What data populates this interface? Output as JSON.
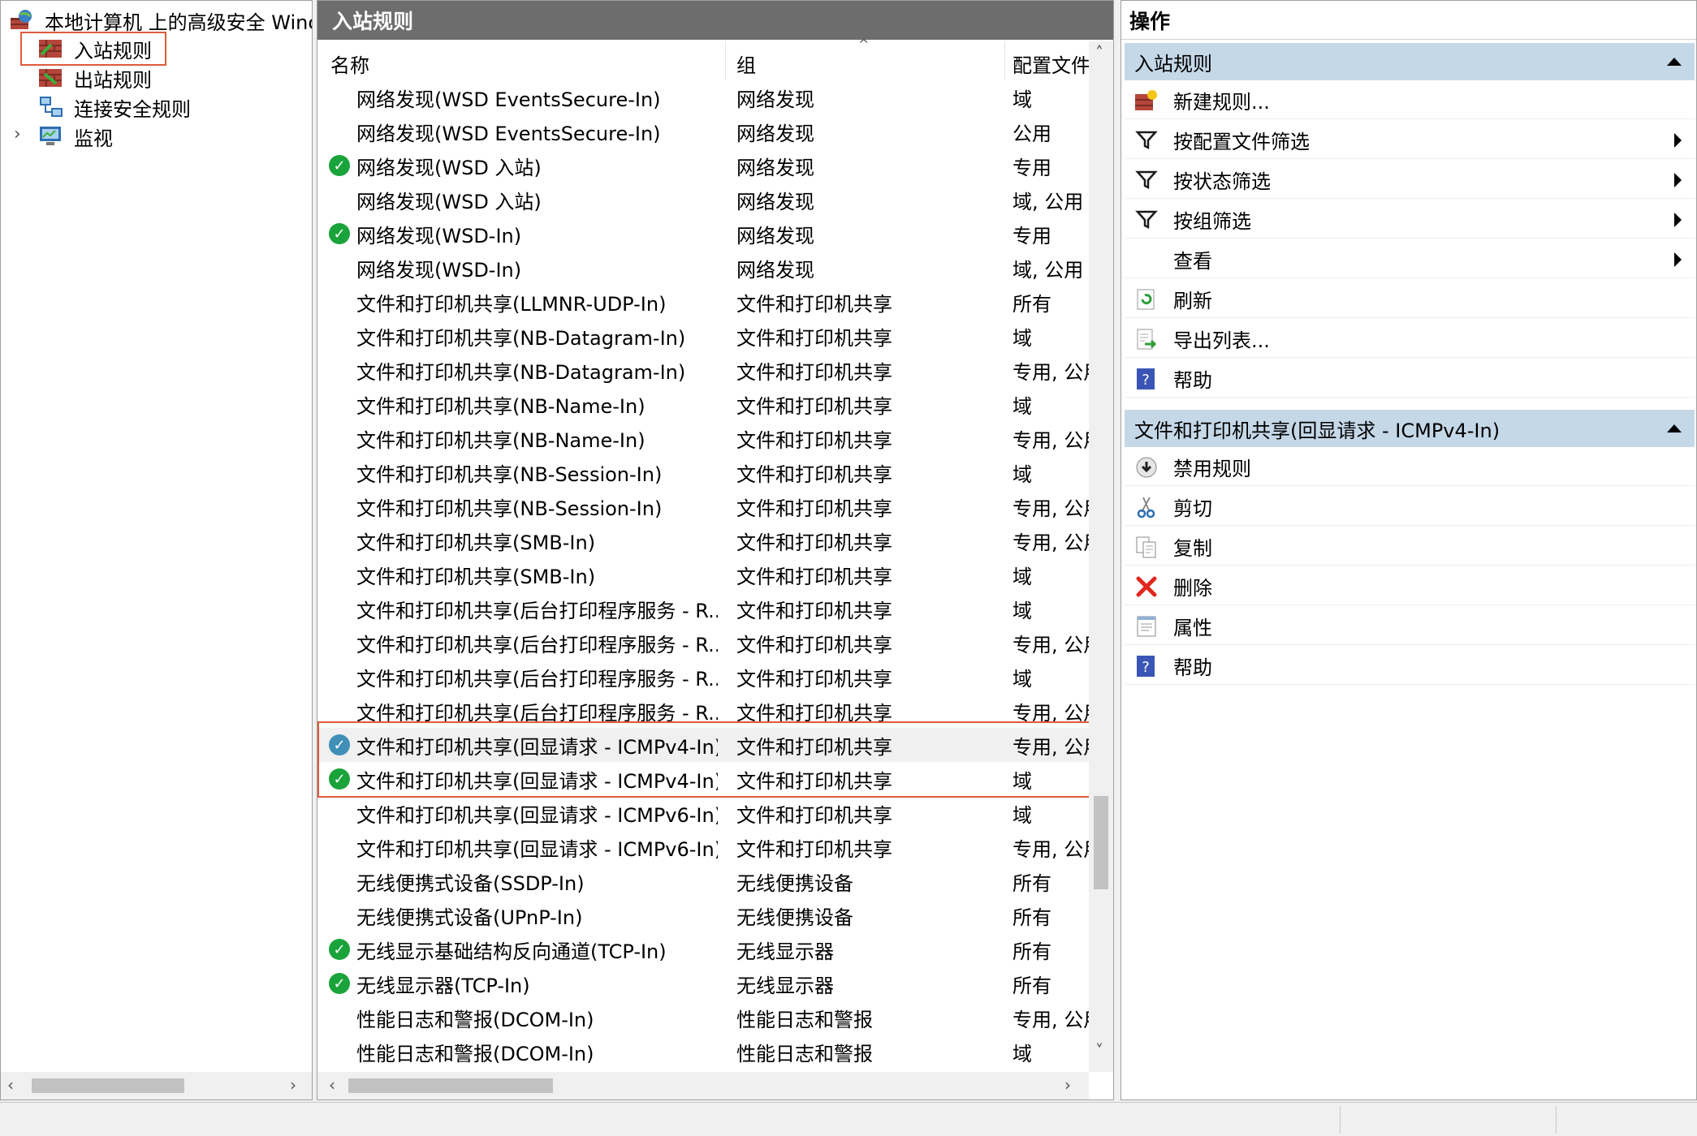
{
  "tree": {
    "root_label": "本地计算机 上的高级安全 Winc",
    "items": [
      {
        "label": "入站规则",
        "icon": "inbound-rules-icon"
      },
      {
        "label": "出站规则",
        "icon": "outbound-rules-icon"
      },
      {
        "label": "连接安全规则",
        "icon": "connection-security-icon"
      },
      {
        "label": "监视",
        "icon": "monitor-icon"
      }
    ]
  },
  "center": {
    "title": "入站规则",
    "columns": {
      "name": "名称",
      "group": "组",
      "profile": "配置文件"
    },
    "rows": [
      {
        "name": "网络发现(WSD EventsSecure-In)",
        "group": "网络发现",
        "profile": "域",
        "enabled": false
      },
      {
        "name": "网络发现(WSD EventsSecure-In)",
        "group": "网络发现",
        "profile": "公用",
        "enabled": false
      },
      {
        "name": "网络发现(WSD 入站)",
        "group": "网络发现",
        "profile": "专用",
        "enabled": true
      },
      {
        "name": "网络发现(WSD 入站)",
        "group": "网络发现",
        "profile": "域, 公用",
        "enabled": false
      },
      {
        "name": "网络发现(WSD-In)",
        "group": "网络发现",
        "profile": "专用",
        "enabled": true
      },
      {
        "name": "网络发现(WSD-In)",
        "group": "网络发现",
        "profile": "域, 公用",
        "enabled": false
      },
      {
        "name": "文件和打印机共享(LLMNR-UDP-In)",
        "group": "文件和打印机共享",
        "profile": "所有",
        "enabled": false
      },
      {
        "name": "文件和打印机共享(NB-Datagram-In)",
        "group": "文件和打印机共享",
        "profile": "域",
        "enabled": false
      },
      {
        "name": "文件和打印机共享(NB-Datagram-In)",
        "group": "文件和打印机共享",
        "profile": "专用, 公用",
        "enabled": false
      },
      {
        "name": "文件和打印机共享(NB-Name-In)",
        "group": "文件和打印机共享",
        "profile": "域",
        "enabled": false
      },
      {
        "name": "文件和打印机共享(NB-Name-In)",
        "group": "文件和打印机共享",
        "profile": "专用, 公用",
        "enabled": false
      },
      {
        "name": "文件和打印机共享(NB-Session-In)",
        "group": "文件和打印机共享",
        "profile": "域",
        "enabled": false
      },
      {
        "name": "文件和打印机共享(NB-Session-In)",
        "group": "文件和打印机共享",
        "profile": "专用, 公用",
        "enabled": false
      },
      {
        "name": "文件和打印机共享(SMB-In)",
        "group": "文件和打印机共享",
        "profile": "专用, 公用",
        "enabled": false
      },
      {
        "name": "文件和打印机共享(SMB-In)",
        "group": "文件和打印机共享",
        "profile": "域",
        "enabled": false
      },
      {
        "name": "文件和打印机共享(后台打印程序服务 - R...",
        "group": "文件和打印机共享",
        "profile": "域",
        "enabled": false
      },
      {
        "name": "文件和打印机共享(后台打印程序服务 - R...",
        "group": "文件和打印机共享",
        "profile": "专用, 公用",
        "enabled": false
      },
      {
        "name": "文件和打印机共享(后台打印程序服务 - R...",
        "group": "文件和打印机共享",
        "profile": "域",
        "enabled": false
      },
      {
        "name": "文件和打印机共享(后台打印程序服务 - R...",
        "group": "文件和打印机共享",
        "profile": "专用, 公用",
        "enabled": false
      },
      {
        "name": "文件和打印机共享(回显请求 - ICMPv4-In)",
        "group": "文件和打印机共享",
        "profile": "专用, 公用",
        "enabled": true,
        "selected": true
      },
      {
        "name": "文件和打印机共享(回显请求 - ICMPv4-In)",
        "group": "文件和打印机共享",
        "profile": "域",
        "enabled": true
      },
      {
        "name": "文件和打印机共享(回显请求 - ICMPv6-In)",
        "group": "文件和打印机共享",
        "profile": "域",
        "enabled": false
      },
      {
        "name": "文件和打印机共享(回显请求 - ICMPv6-In)",
        "group": "文件和打印机共享",
        "profile": "专用, 公用",
        "enabled": false
      },
      {
        "name": "无线便携式设备(SSDP-In)",
        "group": "无线便携设备",
        "profile": "所有",
        "enabled": false
      },
      {
        "name": "无线便携式设备(UPnP-In)",
        "group": "无线便携设备",
        "profile": "所有",
        "enabled": false
      },
      {
        "name": "无线显示基础结构反向通道(TCP-In)",
        "group": "无线显示器",
        "profile": "所有",
        "enabled": true
      },
      {
        "name": "无线显示器(TCP-In)",
        "group": "无线显示器",
        "profile": "所有",
        "enabled": true
      },
      {
        "name": "性能日志和警报(DCOM-In)",
        "group": "性能日志和警报",
        "profile": "专用, 公用",
        "enabled": false
      },
      {
        "name": "性能日志和警报(DCOM-In)",
        "group": "性能日志和警报",
        "profile": "域",
        "enabled": false
      }
    ]
  },
  "actions": {
    "title": "操作",
    "section1": {
      "title": "入站规则",
      "items": [
        {
          "label": "新建规则...",
          "icon": "new-rule-icon",
          "submenu": false
        },
        {
          "label": "按配置文件筛选",
          "icon": "filter-icon",
          "submenu": true
        },
        {
          "label": "按状态筛选",
          "icon": "filter-icon",
          "submenu": true
        },
        {
          "label": "按组筛选",
          "icon": "filter-icon",
          "submenu": true
        },
        {
          "label": "查看",
          "icon": "",
          "submenu": true
        },
        {
          "label": "刷新",
          "icon": "refresh-icon",
          "submenu": false
        },
        {
          "label": "导出列表...",
          "icon": "export-icon",
          "submenu": false
        },
        {
          "label": "帮助",
          "icon": "help-icon",
          "submenu": false
        }
      ]
    },
    "section2": {
      "title": "文件和打印机共享(回显请求 - ICMPv4-In)",
      "items": [
        {
          "label": "禁用规则",
          "icon": "disable-icon"
        },
        {
          "label": "剪切",
          "icon": "cut-icon"
        },
        {
          "label": "复制",
          "icon": "copy-icon"
        },
        {
          "label": "删除",
          "icon": "delete-icon"
        },
        {
          "label": "属性",
          "icon": "properties-icon"
        },
        {
          "label": "帮助",
          "icon": "help-icon"
        }
      ]
    }
  },
  "colors": {
    "accent": "#c5d8e8",
    "highlight": "#e05a3a",
    "check_green": "#1aa33a",
    "title_bar": "#6d6d6d"
  }
}
